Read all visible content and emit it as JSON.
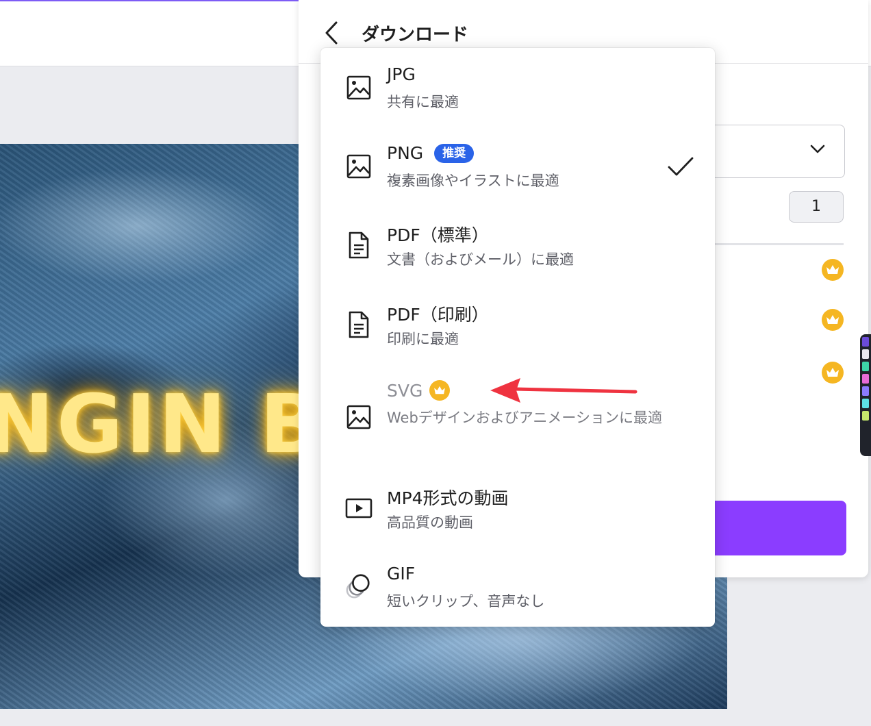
{
  "panel": {
    "title": "ダウンロード",
    "page_count": "1"
  },
  "canvas": {
    "text": "NGIN B"
  },
  "formats": [
    {
      "title": "JPG",
      "desc": "共有に最適",
      "icon": "image-icon"
    },
    {
      "title": "PNG",
      "badge": "推奨",
      "desc": "複素画像やイラストに最適",
      "icon": "image-icon",
      "selected": true
    },
    {
      "title": "PDF（標準）",
      "desc": "文書（およびメール）に最適",
      "icon": "document-icon"
    },
    {
      "title": "PDF（印刷）",
      "desc": "印刷に最適",
      "icon": "document-icon"
    },
    {
      "title": "SVG",
      "desc": "Webデザインおよびアニメーションに最適",
      "icon": "image-icon",
      "premium": true
    },
    {
      "title": "MP4形式の動画",
      "desc": "高品質の動画",
      "icon": "video-icon"
    },
    {
      "title": "GIF",
      "desc": "短いクリップ、音声なし",
      "icon": "gif-icon"
    }
  ],
  "colors": {
    "accent_purple": "#8b3dff",
    "badge_blue": "#2a63e8",
    "crown_gold": "#f5b622",
    "annotation_red": "#ef3340"
  }
}
